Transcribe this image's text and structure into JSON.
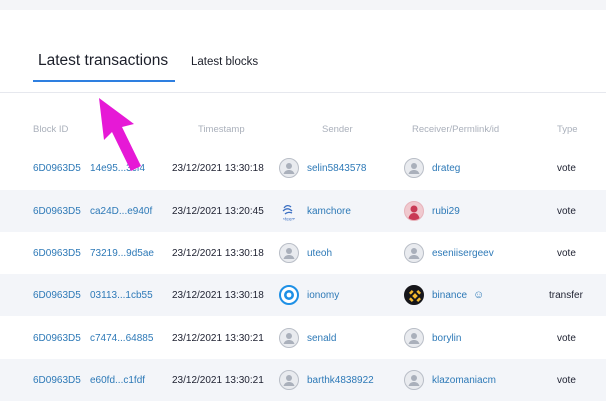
{
  "tabs": [
    {
      "label": "Latest transactions",
      "active": true
    },
    {
      "label": "Latest blocks",
      "active": false
    }
  ],
  "columns": [
    "Block ID",
    "Timestamp",
    "Sender",
    "Receiver/Permlink/id",
    "Type"
  ],
  "rows": [
    {
      "block_id": "6D0963D5",
      "tx": "14e95...3cf4",
      "time": "23/12/2021 13:30:18",
      "sender": "selin5843578",
      "sender_avatar": "user-icon",
      "receiver": "drateg",
      "receiver_avatar": "user-icon",
      "type": "vote"
    },
    {
      "block_id": "6D0963D5",
      "tx": "ca24D...e940f",
      "time": "23/12/2021 13:20:45",
      "sender": "kamchore",
      "sender_avatar": "steem-logo",
      "sender_avatar_label": "steem",
      "receiver": "rubi29",
      "receiver_avatar": "photo-avatar",
      "type": "vote"
    },
    {
      "block_id": "6D0963D5",
      "tx": "73219...9d5ae",
      "time": "23/12/2021 13:30:18",
      "sender": "uteoh",
      "sender_avatar": "user-icon",
      "receiver": "eseniisergeev",
      "receiver_avatar": "user-icon",
      "type": "vote"
    },
    {
      "block_id": "6D0963D5",
      "tx": "03113...1cb55",
      "time": "23/12/2021 13:30:18",
      "sender": "ionomy",
      "sender_avatar": "ionomy-logo",
      "receiver": "binance",
      "receiver_avatar": "binance-logo",
      "receiver_extra_icon": "user-link-icon",
      "type": "transfer"
    },
    {
      "block_id": "6D0963D5",
      "tx": "c7474...64885",
      "time": "23/12/2021 13:30:21",
      "sender": "senald",
      "sender_avatar": "user-icon",
      "receiver": "borylin",
      "receiver_avatar": "user-icon",
      "type": "vote"
    },
    {
      "block_id": "6D0963D5",
      "tx": "e60fd...c1fdf",
      "time": "23/12/2021 13:30:21",
      "sender": "barthk4838922",
      "sender_avatar": "user-icon",
      "receiver": "klazomaniacm",
      "receiver_avatar": "user-icon",
      "type": "vote"
    }
  ],
  "colors": {
    "accent": "#2e7fe0",
    "link": "#2d79b7",
    "arrow": "#e619d6"
  }
}
